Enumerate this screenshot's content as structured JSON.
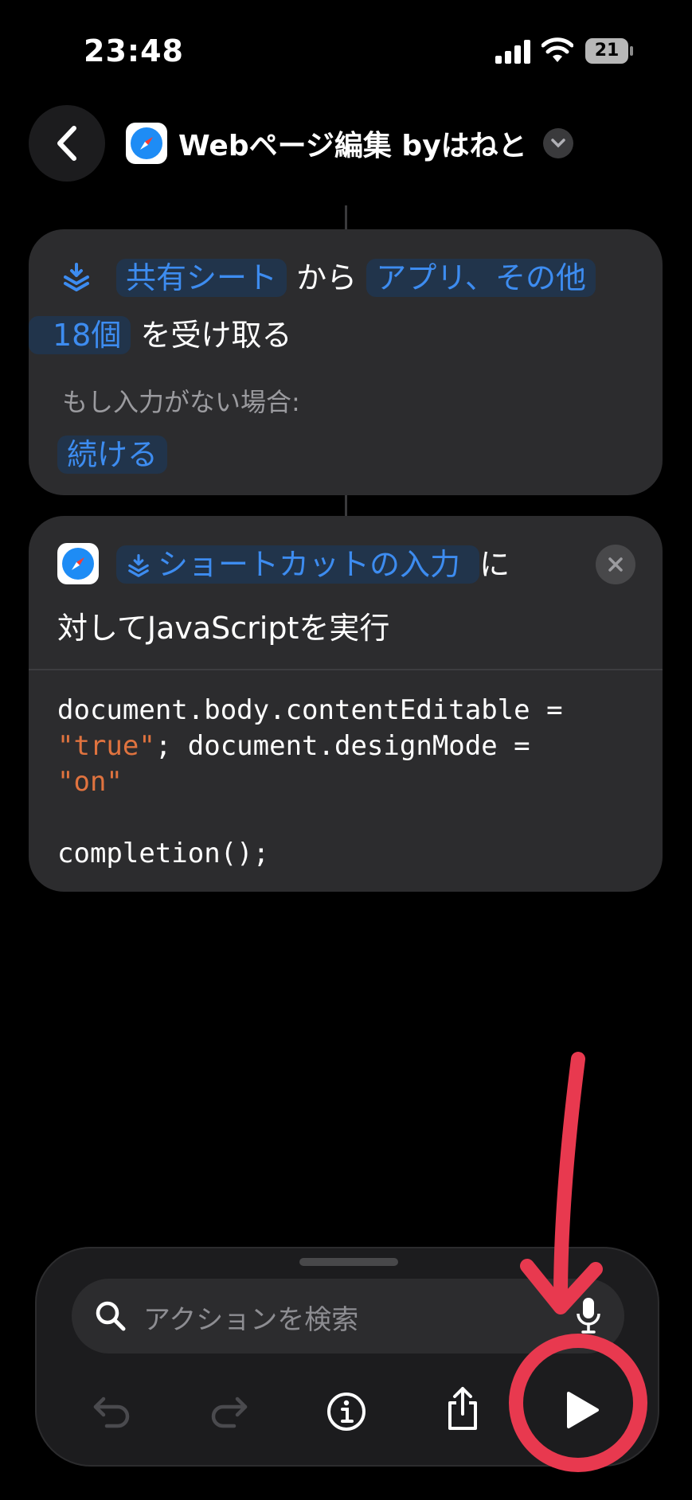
{
  "status_bar": {
    "time": "23:48",
    "battery": "21"
  },
  "nav": {
    "title": "Webページ編集 byはねと"
  },
  "receive_action": {
    "line1_source": "共有シート",
    "line1_mid": "から",
    "line1_types": "アプリ、その他",
    "line2_count": "18個",
    "line2_suffix": "を受け取る",
    "no_input_label": "もし入力がない場合:",
    "no_input_value": "続ける"
  },
  "js_action": {
    "input_token": "ショートカットの入力",
    "suffix_ni": "に",
    "line2": "対してJavaScriptを実行",
    "code": {
      "l1": "document.body.contentEditable =",
      "l2_str": "\"true\"",
      "l2_rest": "; document.designMode =",
      "l3_str": "\"on\"",
      "l5": "completion();"
    }
  },
  "search": {
    "placeholder": "アクションを検索"
  },
  "icons": [
    "chevron-left-icon",
    "safari-icon",
    "chevron-down-icon",
    "share-sheet-icon",
    "close-icon",
    "search-icon",
    "mic-icon",
    "undo-icon",
    "redo-icon",
    "info-icon",
    "share-icon",
    "play-icon"
  ],
  "colors": {
    "accent": "#3d8cf0",
    "string": "#e0733f",
    "annotation": "#e8394f"
  }
}
